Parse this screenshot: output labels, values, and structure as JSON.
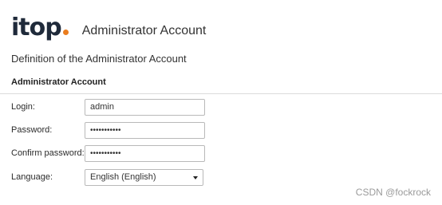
{
  "header": {
    "logo_text": "itop",
    "title": "Administrator Account"
  },
  "subtitle": "Definition of the Administrator Account",
  "section": {
    "title": "Administrator Account"
  },
  "form": {
    "login": {
      "label": "Login:",
      "value": "admin"
    },
    "password": {
      "label": "Password:",
      "value": "•••••••••••"
    },
    "confirm_password": {
      "label": "Confirm password:",
      "value": "•••••••••••"
    },
    "language": {
      "label": "Language:",
      "selected": "English (English)"
    }
  },
  "watermark": "CSDN @fockrock",
  "colors": {
    "logo_dot": "#ea7d1e",
    "logo_text": "#1f2a3a"
  },
  "icons": {
    "dropdown": "chevron-down-icon"
  }
}
